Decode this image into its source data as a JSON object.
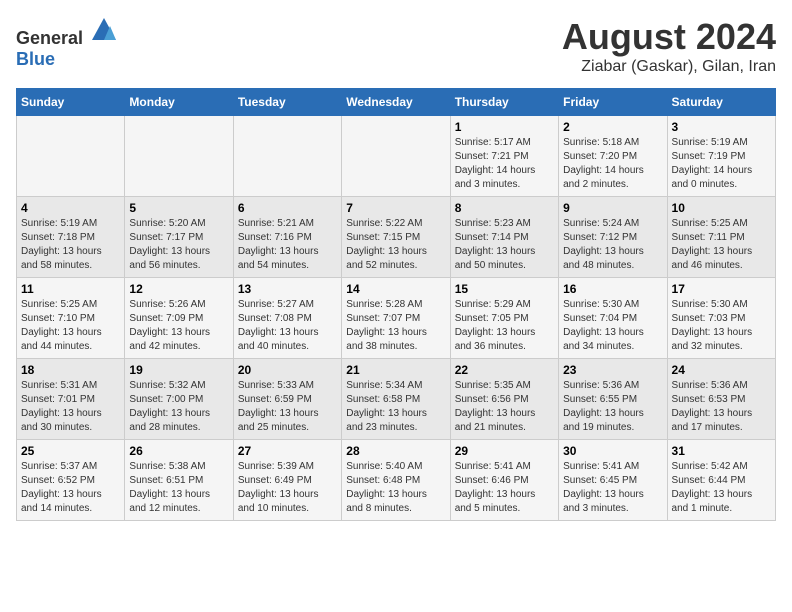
{
  "header": {
    "logo_general": "General",
    "logo_blue": "Blue",
    "main_title": "August 2024",
    "subtitle": "Ziabar (Gaskar), Gilan, Iran"
  },
  "days_of_week": [
    "Sunday",
    "Monday",
    "Tuesday",
    "Wednesday",
    "Thursday",
    "Friday",
    "Saturday"
  ],
  "weeks": [
    {
      "days": [
        {
          "num": "",
          "info": ""
        },
        {
          "num": "",
          "info": ""
        },
        {
          "num": "",
          "info": ""
        },
        {
          "num": "",
          "info": ""
        },
        {
          "num": "1",
          "info": "Sunrise: 5:17 AM\nSunset: 7:21 PM\nDaylight: 14 hours\nand 3 minutes."
        },
        {
          "num": "2",
          "info": "Sunrise: 5:18 AM\nSunset: 7:20 PM\nDaylight: 14 hours\nand 2 minutes."
        },
        {
          "num": "3",
          "info": "Sunrise: 5:19 AM\nSunset: 7:19 PM\nDaylight: 14 hours\nand 0 minutes."
        }
      ]
    },
    {
      "days": [
        {
          "num": "4",
          "info": "Sunrise: 5:19 AM\nSunset: 7:18 PM\nDaylight: 13 hours\nand 58 minutes."
        },
        {
          "num": "5",
          "info": "Sunrise: 5:20 AM\nSunset: 7:17 PM\nDaylight: 13 hours\nand 56 minutes."
        },
        {
          "num": "6",
          "info": "Sunrise: 5:21 AM\nSunset: 7:16 PM\nDaylight: 13 hours\nand 54 minutes."
        },
        {
          "num": "7",
          "info": "Sunrise: 5:22 AM\nSunset: 7:15 PM\nDaylight: 13 hours\nand 52 minutes."
        },
        {
          "num": "8",
          "info": "Sunrise: 5:23 AM\nSunset: 7:14 PM\nDaylight: 13 hours\nand 50 minutes."
        },
        {
          "num": "9",
          "info": "Sunrise: 5:24 AM\nSunset: 7:12 PM\nDaylight: 13 hours\nand 48 minutes."
        },
        {
          "num": "10",
          "info": "Sunrise: 5:25 AM\nSunset: 7:11 PM\nDaylight: 13 hours\nand 46 minutes."
        }
      ]
    },
    {
      "days": [
        {
          "num": "11",
          "info": "Sunrise: 5:25 AM\nSunset: 7:10 PM\nDaylight: 13 hours\nand 44 minutes."
        },
        {
          "num": "12",
          "info": "Sunrise: 5:26 AM\nSunset: 7:09 PM\nDaylight: 13 hours\nand 42 minutes."
        },
        {
          "num": "13",
          "info": "Sunrise: 5:27 AM\nSunset: 7:08 PM\nDaylight: 13 hours\nand 40 minutes."
        },
        {
          "num": "14",
          "info": "Sunrise: 5:28 AM\nSunset: 7:07 PM\nDaylight: 13 hours\nand 38 minutes."
        },
        {
          "num": "15",
          "info": "Sunrise: 5:29 AM\nSunset: 7:05 PM\nDaylight: 13 hours\nand 36 minutes."
        },
        {
          "num": "16",
          "info": "Sunrise: 5:30 AM\nSunset: 7:04 PM\nDaylight: 13 hours\nand 34 minutes."
        },
        {
          "num": "17",
          "info": "Sunrise: 5:30 AM\nSunset: 7:03 PM\nDaylight: 13 hours\nand 32 minutes."
        }
      ]
    },
    {
      "days": [
        {
          "num": "18",
          "info": "Sunrise: 5:31 AM\nSunset: 7:01 PM\nDaylight: 13 hours\nand 30 minutes."
        },
        {
          "num": "19",
          "info": "Sunrise: 5:32 AM\nSunset: 7:00 PM\nDaylight: 13 hours\nand 28 minutes."
        },
        {
          "num": "20",
          "info": "Sunrise: 5:33 AM\nSunset: 6:59 PM\nDaylight: 13 hours\nand 25 minutes."
        },
        {
          "num": "21",
          "info": "Sunrise: 5:34 AM\nSunset: 6:58 PM\nDaylight: 13 hours\nand 23 minutes."
        },
        {
          "num": "22",
          "info": "Sunrise: 5:35 AM\nSunset: 6:56 PM\nDaylight: 13 hours\nand 21 minutes."
        },
        {
          "num": "23",
          "info": "Sunrise: 5:36 AM\nSunset: 6:55 PM\nDaylight: 13 hours\nand 19 minutes."
        },
        {
          "num": "24",
          "info": "Sunrise: 5:36 AM\nSunset: 6:53 PM\nDaylight: 13 hours\nand 17 minutes."
        }
      ]
    },
    {
      "days": [
        {
          "num": "25",
          "info": "Sunrise: 5:37 AM\nSunset: 6:52 PM\nDaylight: 13 hours\nand 14 minutes."
        },
        {
          "num": "26",
          "info": "Sunrise: 5:38 AM\nSunset: 6:51 PM\nDaylight: 13 hours\nand 12 minutes."
        },
        {
          "num": "27",
          "info": "Sunrise: 5:39 AM\nSunset: 6:49 PM\nDaylight: 13 hours\nand 10 minutes."
        },
        {
          "num": "28",
          "info": "Sunrise: 5:40 AM\nSunset: 6:48 PM\nDaylight: 13 hours\nand 8 minutes."
        },
        {
          "num": "29",
          "info": "Sunrise: 5:41 AM\nSunset: 6:46 PM\nDaylight: 13 hours\nand 5 minutes."
        },
        {
          "num": "30",
          "info": "Sunrise: 5:41 AM\nSunset: 6:45 PM\nDaylight: 13 hours\nand 3 minutes."
        },
        {
          "num": "31",
          "info": "Sunrise: 5:42 AM\nSunset: 6:44 PM\nDaylight: 13 hours\nand 1 minute."
        }
      ]
    }
  ]
}
